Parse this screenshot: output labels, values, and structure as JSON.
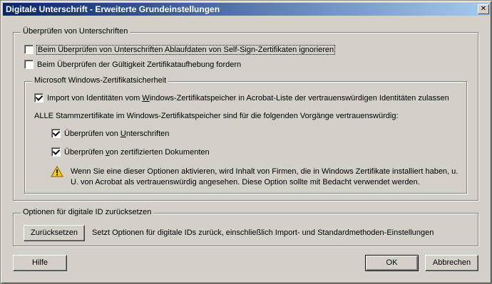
{
  "window": {
    "title": "Digitale Unterschrift - Erweiterte Grundeinstellungen",
    "close_glyph": "✕"
  },
  "verify": {
    "legend": "Überprüfen von Unterschriften",
    "opt1_label": "Beim Überprüfen von Unterschriften Ablaufdaten von Self-Sign-Zertifikaten ignorieren",
    "opt1_checked": false,
    "opt2_label": "Beim Überprüfen der Gültigkeit Zertifikataufhebung fordern",
    "opt2_checked": false
  },
  "windows_store": {
    "legend": "Microsoft Windows-Zertifikatsicherheit",
    "import_label_pre": "Import von Identitäten vom ",
    "import_label_u": "W",
    "import_label_post": "indows-Zertifikatspeicher in Acrobat-Liste der vertrauenswürdigen Identitäten zulassen",
    "import_checked": true,
    "root_text": "ALLE Stammzertifikate im Windows-Zertifikatspeicher sind für die folgenden Vorgänge vertrauenswürdig:",
    "sub1_pre": "Überprüfen von ",
    "sub1_u": "U",
    "sub1_post": "nterschriften",
    "sub1_checked": true,
    "sub2_pre": "Überprüfen ",
    "sub2_u": "v",
    "sub2_post": "on zertifizierten Dokumenten",
    "sub2_checked": true,
    "warning_line1": "Wenn Sie eine dieser Optionen aktivieren, wird Inhalt von Firmen, die in Windows Zertifikate installiert haben, u.",
    "warning_line2": "U. von Acrobat als vertrauenswürdig angesehen. Diese Option sollte mit Bedacht verwendet werden."
  },
  "reset": {
    "legend": "Optionen für digitale ID zurücksetzen",
    "button_label": "Zurücksetzen",
    "description": "Setzt Optionen für digitale IDs zurück, einschließlich Import- und Standardmethoden-Einstellungen"
  },
  "footer": {
    "help_label": "Hilfe",
    "ok_label": "OK",
    "cancel_label": "Abbrechen"
  },
  "icons": {
    "close": "close-icon",
    "warning": "warning-icon"
  }
}
